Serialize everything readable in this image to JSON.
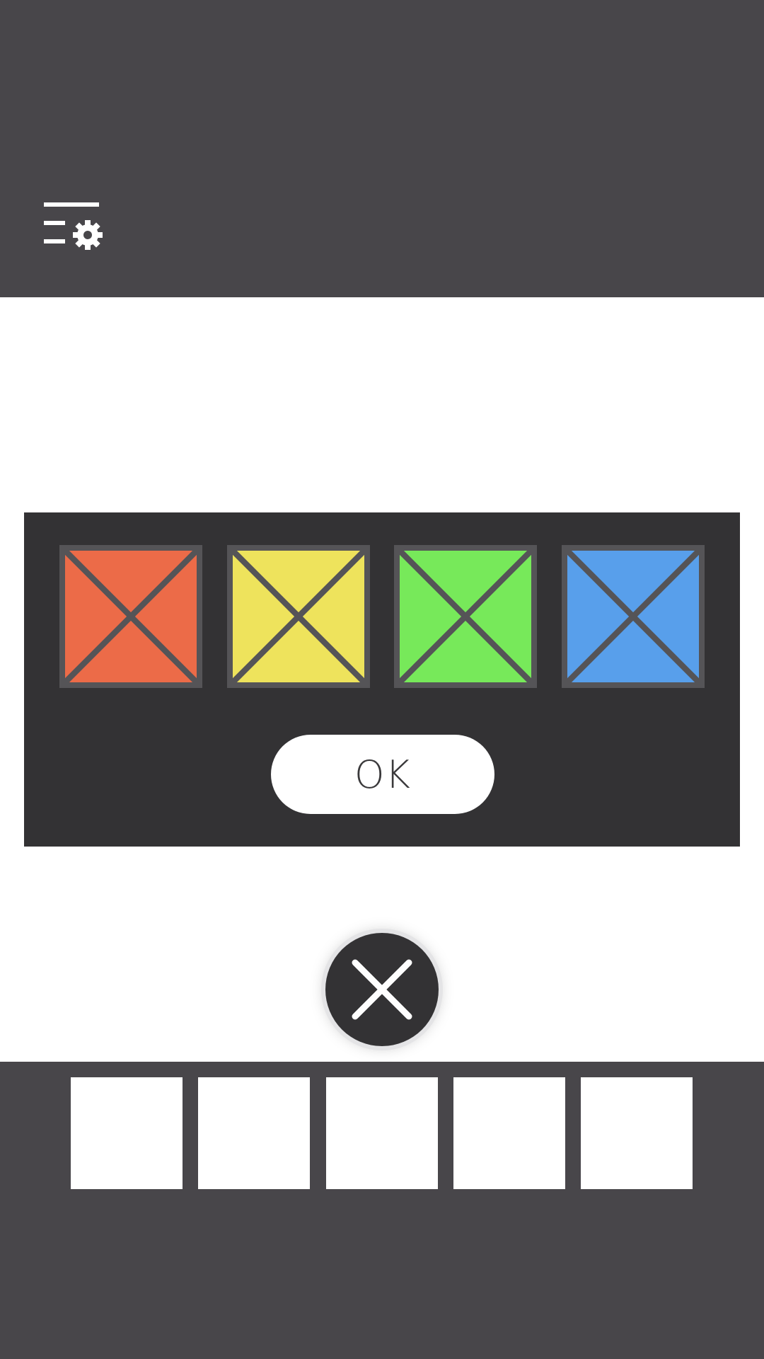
{
  "colors": {
    "header_bg": "#48464a",
    "main_bg": "#ffffff",
    "panel_bg": "#333234",
    "tile_border": "#555457",
    "tile_cross": "#555457",
    "ok_bg": "#ffffff",
    "ok_text": "#3a393b",
    "close_bg": "#333234",
    "close_x": "#ffffff",
    "inventory_bg": "#48464a",
    "slot_bg": "#ffffff"
  },
  "header": {
    "menu_icon": "menu-settings-icon"
  },
  "puzzle": {
    "tiles": [
      {
        "color_name": "red",
        "color": "#ec6b48"
      },
      {
        "color_name": "yellow",
        "color": "#eee35c"
      },
      {
        "color_name": "green",
        "color": "#77e95a"
      },
      {
        "color_name": "blue",
        "color": "#589feb"
      }
    ],
    "ok_label": "OK"
  },
  "close_button": {
    "icon": "close-icon"
  },
  "inventory": {
    "slot_count": 5
  }
}
